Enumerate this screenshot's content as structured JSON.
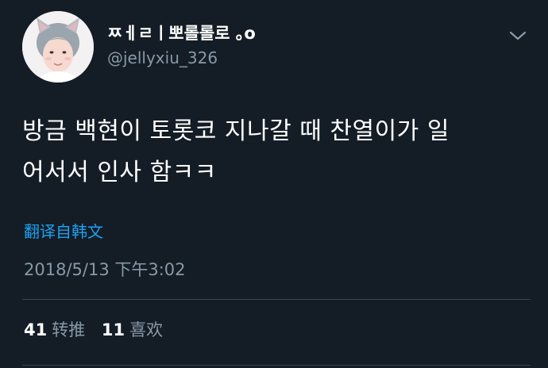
{
  "user": {
    "display_name": "ㅉㅔㄹㅣ뽀롤롤로 ｡o",
    "handle": "@jellyxiu_326"
  },
  "tweet": {
    "lines": [
      "방금 백현이 토롯코 지나갈 때 찬열이가 일",
      "어서서 인사 함ㅋㅋ"
    ],
    "translate_label": "翻译自韩文",
    "timestamp": "2018/5/13 下午3:02"
  },
  "stats": {
    "retweets_count": "41",
    "retweets_label": "转推",
    "likes_count": "11",
    "likes_label": "喜欢"
  },
  "icons": {
    "more": "chevron-down-icon"
  },
  "colors": {
    "background": "#141d26",
    "text": "#ffffff",
    "secondary": "#8899a6",
    "link": "#1da1f2",
    "divider": "#38444d"
  }
}
